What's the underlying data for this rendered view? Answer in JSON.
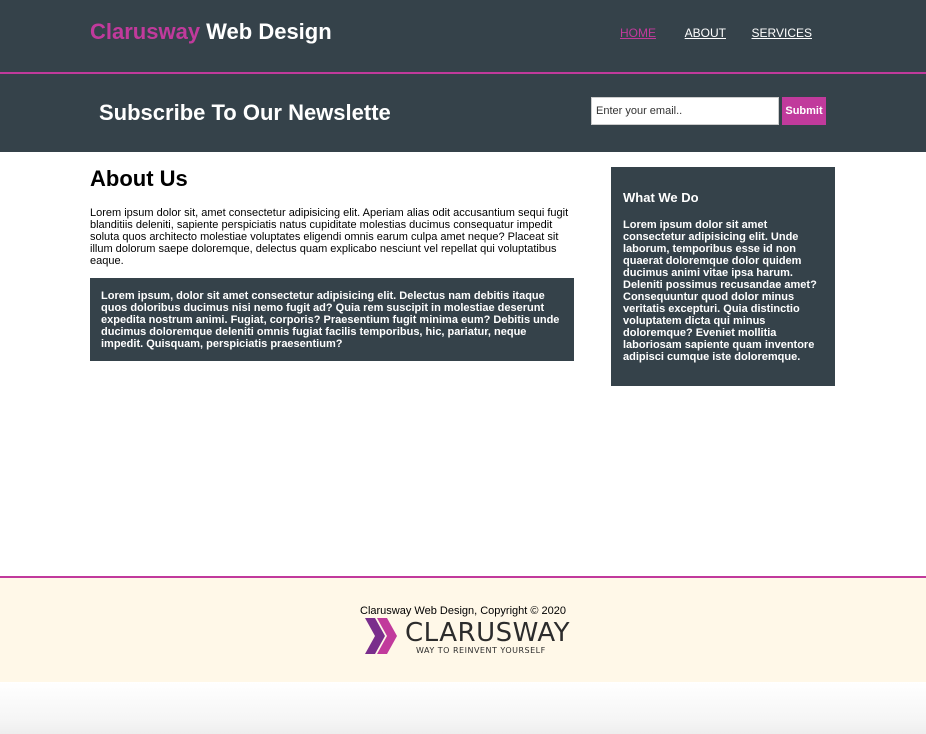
{
  "header": {
    "brand_highlight": "Clarusway",
    "brand_rest": " Web Design",
    "nav": [
      {
        "label": "HOME",
        "current": true
      },
      {
        "label": "ABOUT",
        "current": false
      },
      {
        "label": "SERVICES",
        "current": false
      }
    ]
  },
  "newsletter": {
    "title": "Subscribe To Our Newslette",
    "email_placeholder": "Enter your email..",
    "submit_label": "Submit"
  },
  "main": {
    "title": "About Us",
    "intro": "Lorem ipsum dolor sit, amet consectetur adipisicing elit. Aperiam alias odit accusantium sequi fugit blanditiis deleniti, sapiente perspiciatis natus cupiditate molestias ducimus consequatur impedit soluta quos architecto molestiae voluptates eligendi omnis earum culpa amet neque? Placeat sit illum dolorum saepe doloremque, delectus quam explicabo nesciunt vel repellat qui voluptatibus eaque.",
    "dark_box": "Lorem ipsum, dolor sit amet consectetur adipisicing elit. Delectus nam debitis itaque quos doloribus ducimus nisi nemo fugit ad? Quia rem suscipit in molestiae deserunt expedita nostrum animi. Fugiat, corporis? Praesentium fugit minima eum? Debitis unde ducimus doloremque deleniti omnis fugiat facilis temporibus, hic, pariatur, neque impedit. Quisquam, perspiciatis praesentium?"
  },
  "sidebar": {
    "title": "What We Do",
    "text": "Lorem ipsum dolor sit amet consectetur adipisicing elit. Unde laborum, temporibus esse id non quaerat doloremque dolor quidem ducimus animi vitae ipsa harum. Deleniti possimus recusandae amet? Consequuntur quod dolor minus veritatis excepturi. Quia distinctio voluptatem dicta qui minus doloremque? Eveniet mollitia laboriosam sapiente quam inventore adipisci cumque iste doloremque."
  },
  "footer": {
    "copyright": "Clarusway Web Design, Copyright © 2020",
    "logo_name": "CLARUSWAY",
    "logo_tagline": "WAY TO REINVENT YOURSELF",
    "logo_icon": "chevron-double-icon"
  },
  "colors": {
    "dark": "#35424a",
    "accent": "#c13a9c",
    "footer_bg": "#fff8e8"
  }
}
